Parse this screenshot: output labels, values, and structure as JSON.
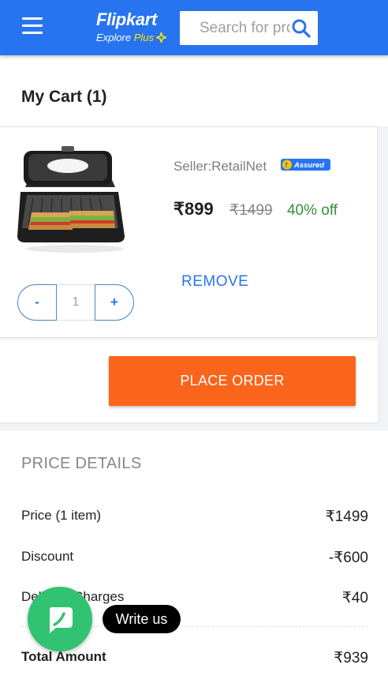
{
  "header": {
    "logo_main": "Flipkart",
    "logo_sub_explore": "Explore",
    "logo_sub_plus": "Plus",
    "search_placeholder": "Search for products",
    "brand_color": "#2874f0"
  },
  "cart": {
    "title": "My Cart (1)",
    "item": {
      "seller": "Seller:RetailNet",
      "assured_badge": "Assured",
      "price": "₹899",
      "mrp": "₹1499",
      "discount": "40% off",
      "remove_label": "REMOVE",
      "quantity": "1",
      "qty_minus": "-",
      "qty_plus": "+"
    },
    "place_order_label": "PLACE ORDER"
  },
  "price_details": {
    "title": "PRICE DETAILS",
    "rows": [
      {
        "label": "Price (1 item)",
        "value": "₹1499"
      },
      {
        "label": "Discount",
        "value": "-₹600"
      },
      {
        "label": "Delivery Charges",
        "value": "₹40"
      }
    ],
    "total_label": "Total Amount",
    "total_value": "₹939"
  },
  "chat": {
    "write_us_label": "Write us",
    "icon": "chat-bubble-icon"
  },
  "colors": {
    "accent": "#2874f0",
    "order_button": "#fb641b",
    "discount_green": "#388e3c",
    "chat_green": "#32c372"
  }
}
